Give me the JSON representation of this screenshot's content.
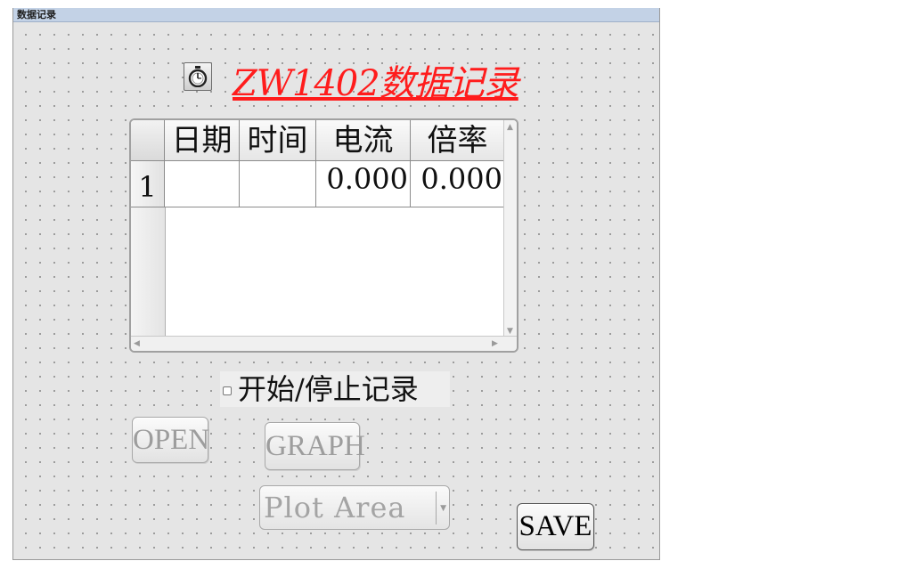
{
  "window": {
    "title": "数据记录"
  },
  "header": {
    "icon": "stopwatch-icon",
    "title": "ZW1402数据记录"
  },
  "table": {
    "columns": [
      "日期",
      "时间",
      "电流",
      "倍率"
    ],
    "rows": [
      {
        "row_number": "1",
        "cells": [
          "",
          "",
          "0.000",
          "0.000"
        ]
      }
    ]
  },
  "controls": {
    "record_checkbox_label": "开始/停止记录",
    "record_checkbox_checked": false,
    "open_label": "OPEN",
    "graph_label": "GRAPH",
    "plot_select_value": "Plot Area",
    "save_label": "SAVE"
  },
  "colors": {
    "title": "#ff1c1c",
    "titlebar": "#c3d2e6",
    "disabled_text": "#9d9d9d"
  }
}
